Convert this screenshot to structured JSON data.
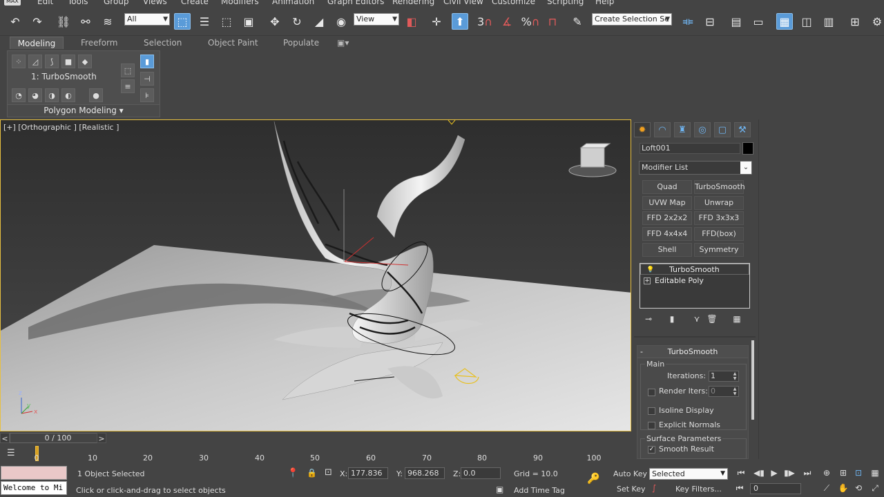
{
  "menu": {
    "logo": "MAX",
    "items": [
      "Edit",
      "Tools",
      "Group",
      "Views",
      "Create",
      "Modifiers",
      "Animation",
      "Graph Editors",
      "Rendering",
      "Civil View",
      "Customize",
      "Scripting",
      "Help"
    ]
  },
  "toolbar": {
    "selection_filter": "All",
    "ref_coord": "View",
    "named_selection": "Create Selection Se",
    "snap_label": "3",
    "percent_label": "%"
  },
  "ribbon": {
    "tabs": [
      "Modeling",
      "Freeform",
      "Selection",
      "Object Paint",
      "Populate"
    ],
    "active_tab": "Modeling",
    "modifier_label": "1: TurboSmooth",
    "footer": "Polygon Modeling"
  },
  "viewport": {
    "label": "[+] [Orthographic ] [Realistic ]",
    "axis_x": "x",
    "axis_y": "y",
    "axis_z": "z"
  },
  "command_panel": {
    "object_name": "Loft001",
    "object_color": "#000000",
    "modifier_list": "Modifier List",
    "modifier_buttons": [
      "Quad Chamfer",
      "TurboSmooth",
      "UVW Map",
      "Unwrap UVW",
      "FFD 2x2x2",
      "FFD 3x3x3",
      "FFD 4x4x4",
      "FFD(box)",
      "Shell",
      "Symmetry"
    ],
    "stack": [
      "TurboSmooth",
      "Editable Poly"
    ],
    "rollout": {
      "title": "TurboSmooth",
      "main_group": "Main",
      "iterations_label": "Iterations:",
      "iterations_value": "1",
      "render_iters_label": "Render Iters:",
      "render_iters_value": "0",
      "isoline_label": "Isoline Display",
      "explicit_normals_label": "Explicit Normals",
      "surface_group": "Surface Parameters",
      "smooth_result_label": "Smooth Result"
    }
  },
  "timeline": {
    "slider": "0 / 100",
    "ticks": [
      "0",
      "10",
      "20",
      "30",
      "40",
      "50",
      "60",
      "70",
      "80",
      "90",
      "100"
    ]
  },
  "status": {
    "maxscript": "Welcome to Mi",
    "selection": "1 Object Selected",
    "prompt": "Click or click-and-drag to select objects",
    "x_label": "X:",
    "x_value": "177.836",
    "y_label": "Y:",
    "y_value": "968.268",
    "z_label": "Z:",
    "z_value": "0.0",
    "grid": "Grid = 10.0",
    "add_time_tag": "Add Time Tag",
    "auto_key": "Auto Key",
    "set_key": "Set Key",
    "key_mode": "Selected",
    "key_filters": "Key Filters...",
    "frame": "0"
  }
}
